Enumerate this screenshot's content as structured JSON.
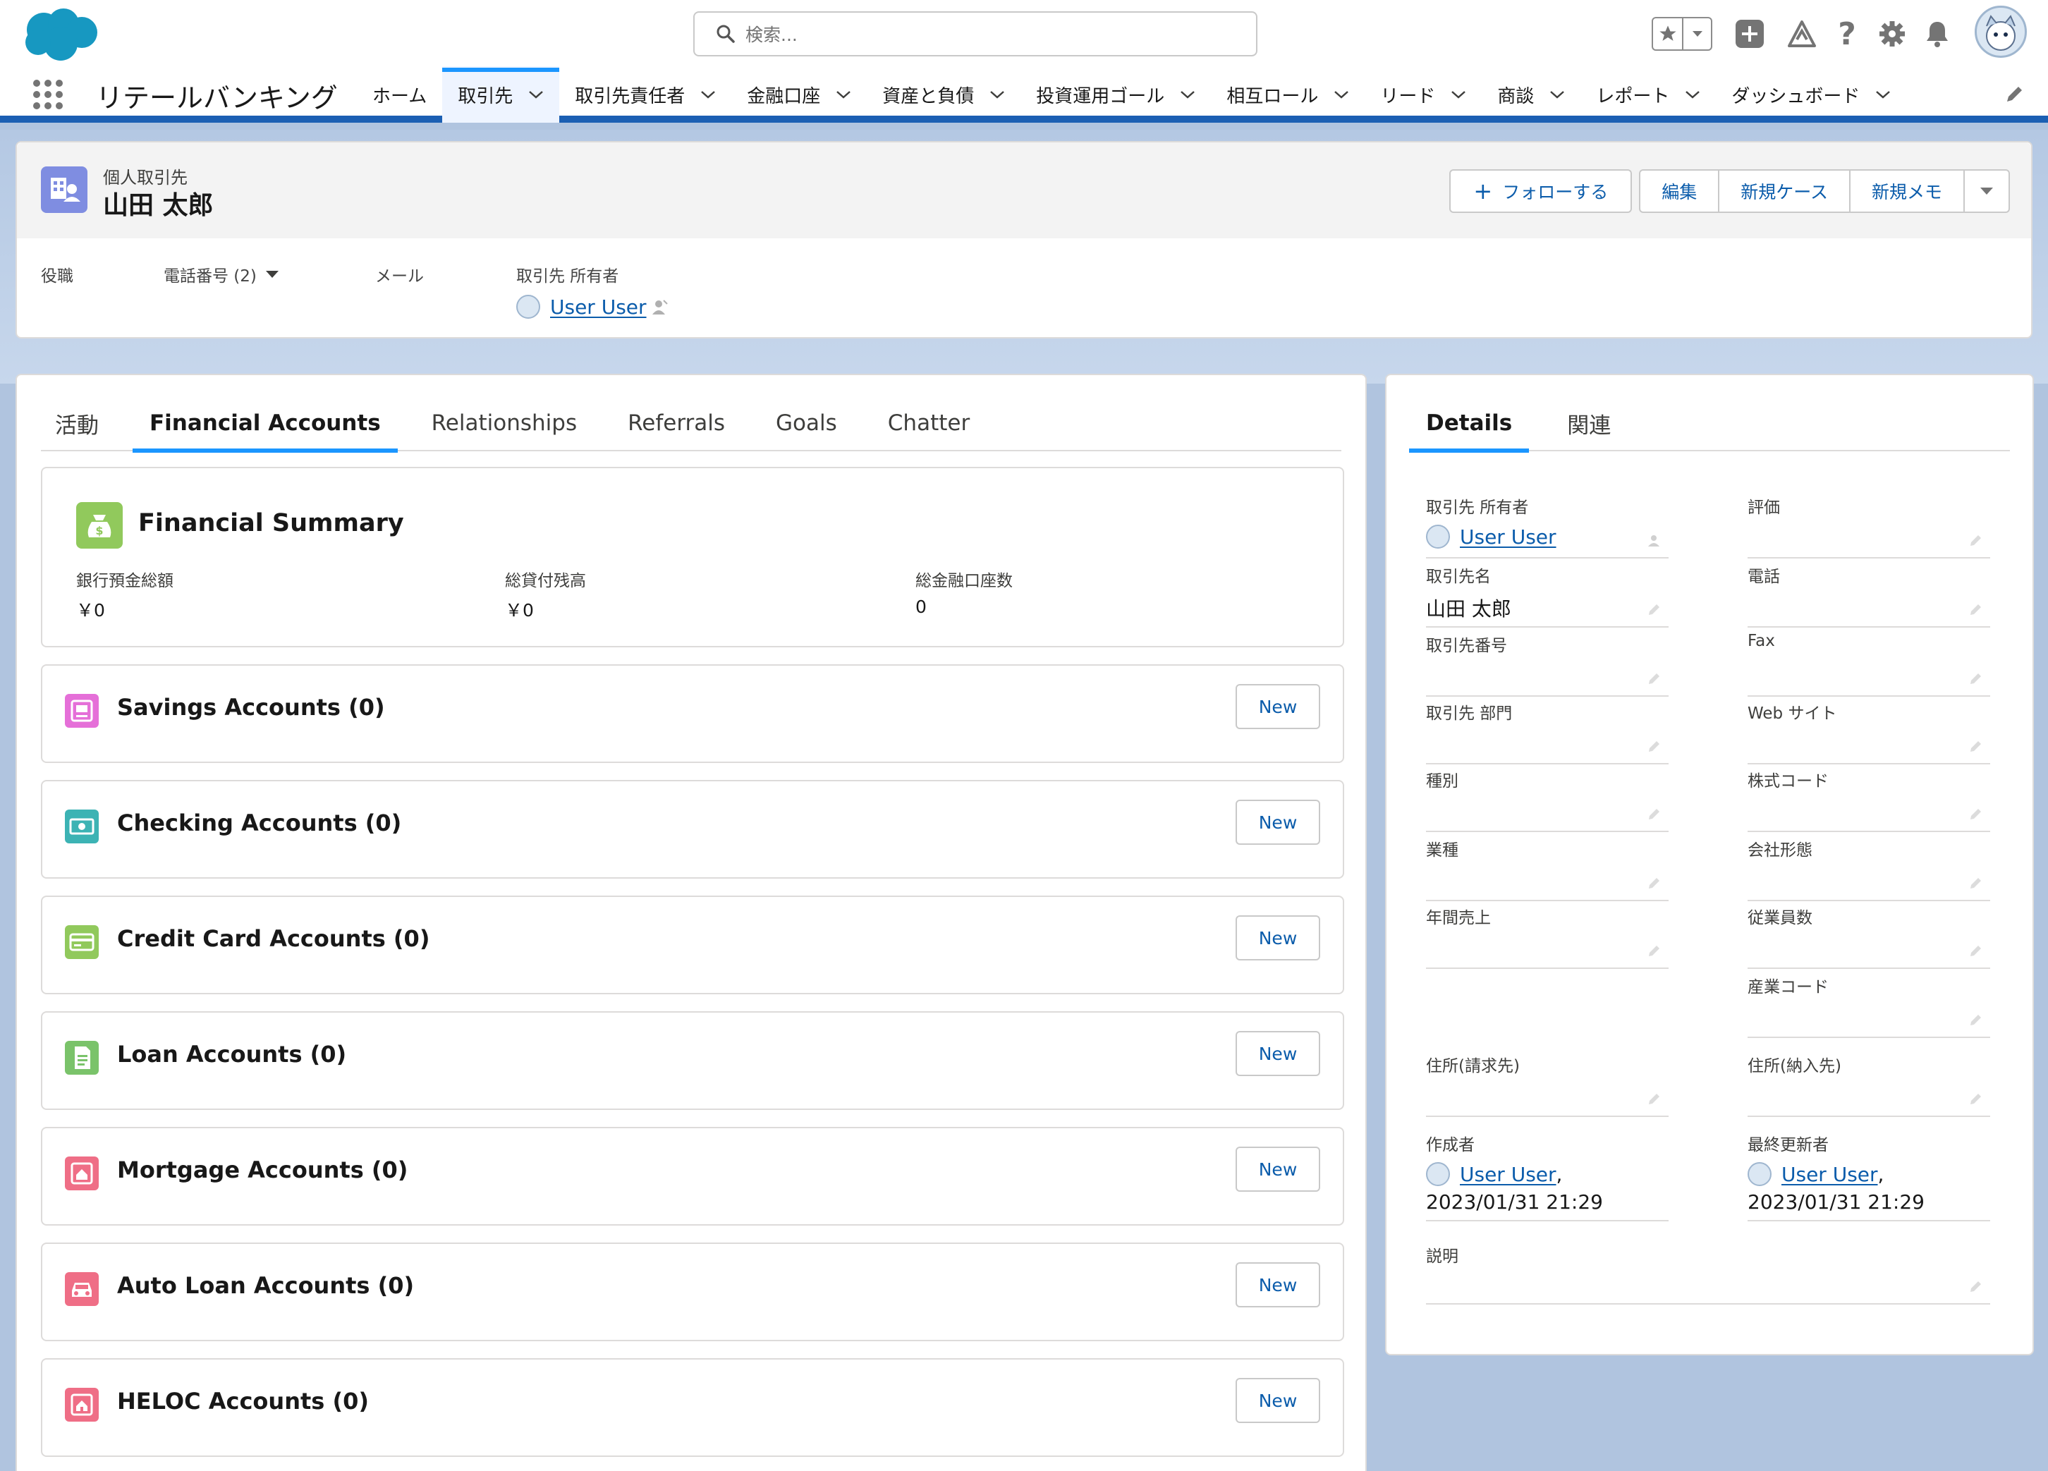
{
  "colors": {
    "brand_blue": "#1b5fb3",
    "accent": "#1b96ff",
    "link": "#0b5cab"
  },
  "search": {
    "placeholder": "検索..."
  },
  "app": {
    "name": "リテールバンキング"
  },
  "nav": {
    "items": [
      {
        "label": "ホーム",
        "has_menu": false,
        "active": false
      },
      {
        "label": "取引先",
        "has_menu": true,
        "active": true
      },
      {
        "label": "取引先責任者",
        "has_menu": true,
        "active": false
      },
      {
        "label": "金融口座",
        "has_menu": true,
        "active": false
      },
      {
        "label": "資産と負債",
        "has_menu": true,
        "active": false
      },
      {
        "label": "投資運用ゴール",
        "has_menu": true,
        "active": false
      },
      {
        "label": "相互ロール",
        "has_menu": true,
        "active": false
      },
      {
        "label": "リード",
        "has_menu": true,
        "active": false
      },
      {
        "label": "商談",
        "has_menu": true,
        "active": false
      },
      {
        "label": "レポート",
        "has_menu": true,
        "active": false
      },
      {
        "label": "ダッシュボード",
        "has_menu": true,
        "active": false
      }
    ]
  },
  "record": {
    "type": "個人取引先",
    "name": "山田 太郎",
    "actions": {
      "follow": "フォローする",
      "edit": "編集",
      "new_case": "新規ケース",
      "new_note": "新規メモ"
    },
    "highlights": {
      "title_label": "役職",
      "phone_label": "電話番号 (2)",
      "email_label": "メール",
      "owner_label": "取引先 所有者",
      "owner_name": "User User"
    }
  },
  "main_tabs": [
    "活動",
    "Financial Accounts",
    "Relationships",
    "Referrals",
    "Goals",
    "Chatter"
  ],
  "summary": {
    "title": "Financial Summary",
    "items": [
      {
        "label": "銀行預金総額",
        "value": "￥0"
      },
      {
        "label": "総貸付残高",
        "value": "￥0"
      },
      {
        "label": "総金融口座数",
        "value": "0"
      }
    ]
  },
  "related_lists": [
    {
      "title": "Savings Accounts (0)",
      "button": "New",
      "icon": "savings-icon",
      "color": "#e56fd8"
    },
    {
      "title": "Checking Accounts (0)",
      "button": "New",
      "icon": "checking-icon",
      "color": "#3cb3b4"
    },
    {
      "title": "Credit Card Accounts (0)",
      "button": "New",
      "icon": "credit-card-icon",
      "color": "#91c95c"
    },
    {
      "title": "Loan Accounts (0)",
      "button": "New",
      "icon": "loan-document-icon",
      "color": "#7ac36a"
    },
    {
      "title": "Mortgage Accounts (0)",
      "button": "New",
      "icon": "mortgage-house-icon",
      "color": "#ef6e86"
    },
    {
      "title": "Auto Loan Accounts (0)",
      "button": "New",
      "icon": "car-icon",
      "color": "#ef6e86"
    },
    {
      "title": "HELOC Accounts (0)",
      "button": "New",
      "icon": "heloc-house-icon",
      "color": "#ef6e86"
    }
  ],
  "side_tabs": [
    "Details",
    "関連"
  ],
  "details": {
    "owner_label": "取引先 所有者",
    "owner_value": "User User",
    "rating_label": "評価",
    "account_name_label": "取引先名",
    "account_name_value": "山田 太郎",
    "phone_label": "電話",
    "account_number_label": "取引先番号",
    "fax_label": "Fax",
    "division_label": "取引先 部門",
    "website_label": "Web サイト",
    "type_label": "種別",
    "ticker_label": "株式コード",
    "industry_label": "業種",
    "ownership_label": "会社形態",
    "revenue_label": "年間売上",
    "employees_label": "従業員数",
    "sic_label": "産業コード",
    "billing_label": "住所(請求先)",
    "shipping_label": "住所(納入先)",
    "created_label": "作成者",
    "created_user": "User User",
    "created_date": "2023/01/31 21:29",
    "modified_label": "最終更新者",
    "modified_user": "User User",
    "modified_date": "2023/01/31 21:29",
    "description_label": "説明"
  }
}
